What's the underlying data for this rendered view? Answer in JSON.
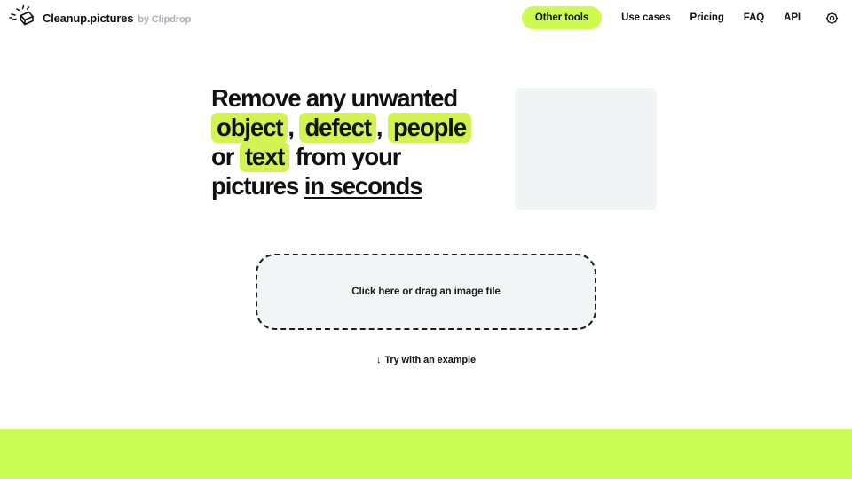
{
  "header": {
    "logo_icon": "eraser-sparkle-icon",
    "brand_name": "Cleanup.pictures",
    "brand_by": "by Clipdrop",
    "nav": {
      "pill_label": "Other tools",
      "links": [
        {
          "label": "Use cases"
        },
        {
          "label": "Pricing"
        },
        {
          "label": "FAQ"
        },
        {
          "label": "API"
        }
      ],
      "settings_icon": "gear-icon"
    }
  },
  "hero": {
    "headline": {
      "part1": "Remove any unwanted",
      "hl1": "object",
      "sep1": ",",
      "hl2": "defect",
      "sep2": ",",
      "hl3": "people",
      "part2": "or",
      "hl4": "text",
      "part3": "from your pictures",
      "underlined": "in seconds"
    },
    "media_placeholder": "image-placeholder"
  },
  "upload": {
    "dropzone_label": "Click here or drag an image file",
    "example_arrow": "↓",
    "example_label": "Try with an example"
  },
  "colors": {
    "lime_band": "#c9fc55",
    "lime_pill": "#ccfa4f",
    "highlight": "#d2f352",
    "dropzone_bg": "#f2f4f6",
    "placeholder_bg": "#f2f3f5",
    "text": "#111111",
    "muted": "#a9aeb5"
  }
}
